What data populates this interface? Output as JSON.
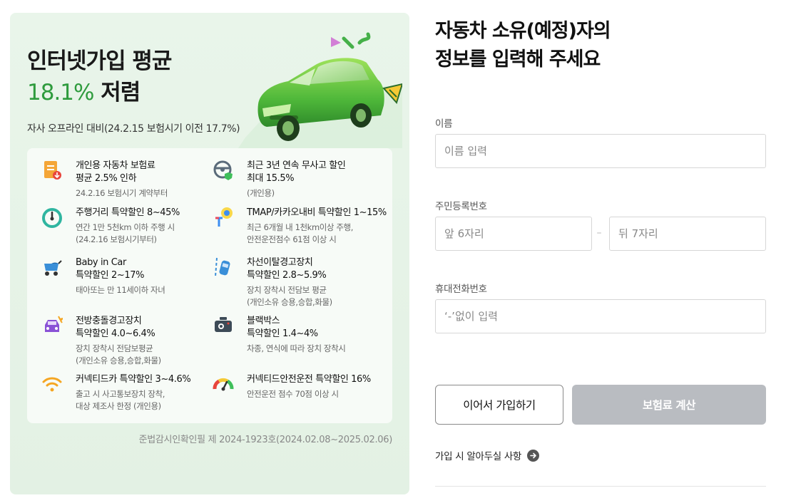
{
  "promo": {
    "headline_line1": "인터넷가입 평균",
    "headline_rate": "18.1%",
    "headline_suffix": " 저렴",
    "subtext": "자사 오프라인 대비(24.2.15 보험시기 이전 17.7%)",
    "benefits": [
      {
        "icon": "document-discount-icon",
        "title1": "개인용 자동차 보험료",
        "title2": "평균 2.5% 인하",
        "desc1": "24.2.16 보험시기 계약부터",
        "desc2": ""
      },
      {
        "icon": "steering-wheel-shield-icon",
        "title1": "최근 3년 연속 무사고 할인",
        "title2": "최대 15.5%",
        "desc1": "(개인용)",
        "desc2": ""
      },
      {
        "icon": "speedometer-icon",
        "title1": "주행거리 특약할인 8~45%",
        "title2": "",
        "desc1": "연간 1만 5천km 이하 주행 시",
        "desc2": "(24.2.16 보험시기부터)"
      },
      {
        "icon": "navigation-app-icon",
        "title1": "TMAP/카카오내비 특약할인 1~15%",
        "title2": "",
        "desc1": "최근 6개월 내 1천km이상 주행,",
        "desc2": "안전운전점수 61점 이상 시"
      },
      {
        "icon": "baby-stroller-icon",
        "title1": "Baby in Car",
        "title2": "특약할인 2~17%",
        "desc1": "태아또는 만 11세이하 자녀",
        "desc2": ""
      },
      {
        "icon": "lane-departure-icon",
        "title1": "차선이탈경고장치",
        "title2": "특약할인 2.8~5.9%",
        "desc1": "장치 장착시 전담보 평균",
        "desc2": "(개인소유 승용,승합,화물)"
      },
      {
        "icon": "collision-warning-car-icon",
        "title1": "전방충돌경고장치",
        "title2": "특약할인 4.0~6.4%",
        "desc1": "장치 장착시 전담보평균",
        "desc2": "(개인소유 승용,승합,화물)"
      },
      {
        "icon": "dashcam-icon",
        "title1": "블랙박스",
        "title2": "특약할인 1.4~4%",
        "desc1": "차종, 연식에 따라 장치 장착시",
        "desc2": ""
      },
      {
        "icon": "wifi-icon",
        "title1": "커넥티드카 특약할인 3~4.6%",
        "title2": "",
        "desc1": "출고 시 사고통보장치 장착,",
        "desc2": "대상 제조사 한정 (개인용)"
      },
      {
        "icon": "safety-gauge-icon",
        "title1": "커넥티드안전운전 특약할인 16%",
        "title2": "",
        "desc1": "안전운전 점수 70점 이상 시",
        "desc2": ""
      }
    ],
    "notice": "준법감시인확인필 제 2024-1923호(2024.02.08~2025.02.06)"
  },
  "form": {
    "title_line1": "자동차 소유(예정)자의",
    "title_line2": "정보를 입력해 주세요",
    "name_label": "이름",
    "name_placeholder": "이름 입력",
    "rrn_label": "주민등록번호",
    "rrn_front_placeholder": "앞 6자리",
    "rrn_separator": "–",
    "rrn_back_placeholder": "뒤 7자리",
    "phone_label": "휴대전화번호",
    "phone_placeholder": "‘-’없이 입력",
    "continue_button": "이어서 가입하기",
    "calc_button": "보험료 계산",
    "info_link": "가입 시 알아두실 사항"
  },
  "colors": {
    "accent_green": "#2e9b3d",
    "panel_bg": "#e6f3e7",
    "disabled_button": "#b9bcc1"
  }
}
